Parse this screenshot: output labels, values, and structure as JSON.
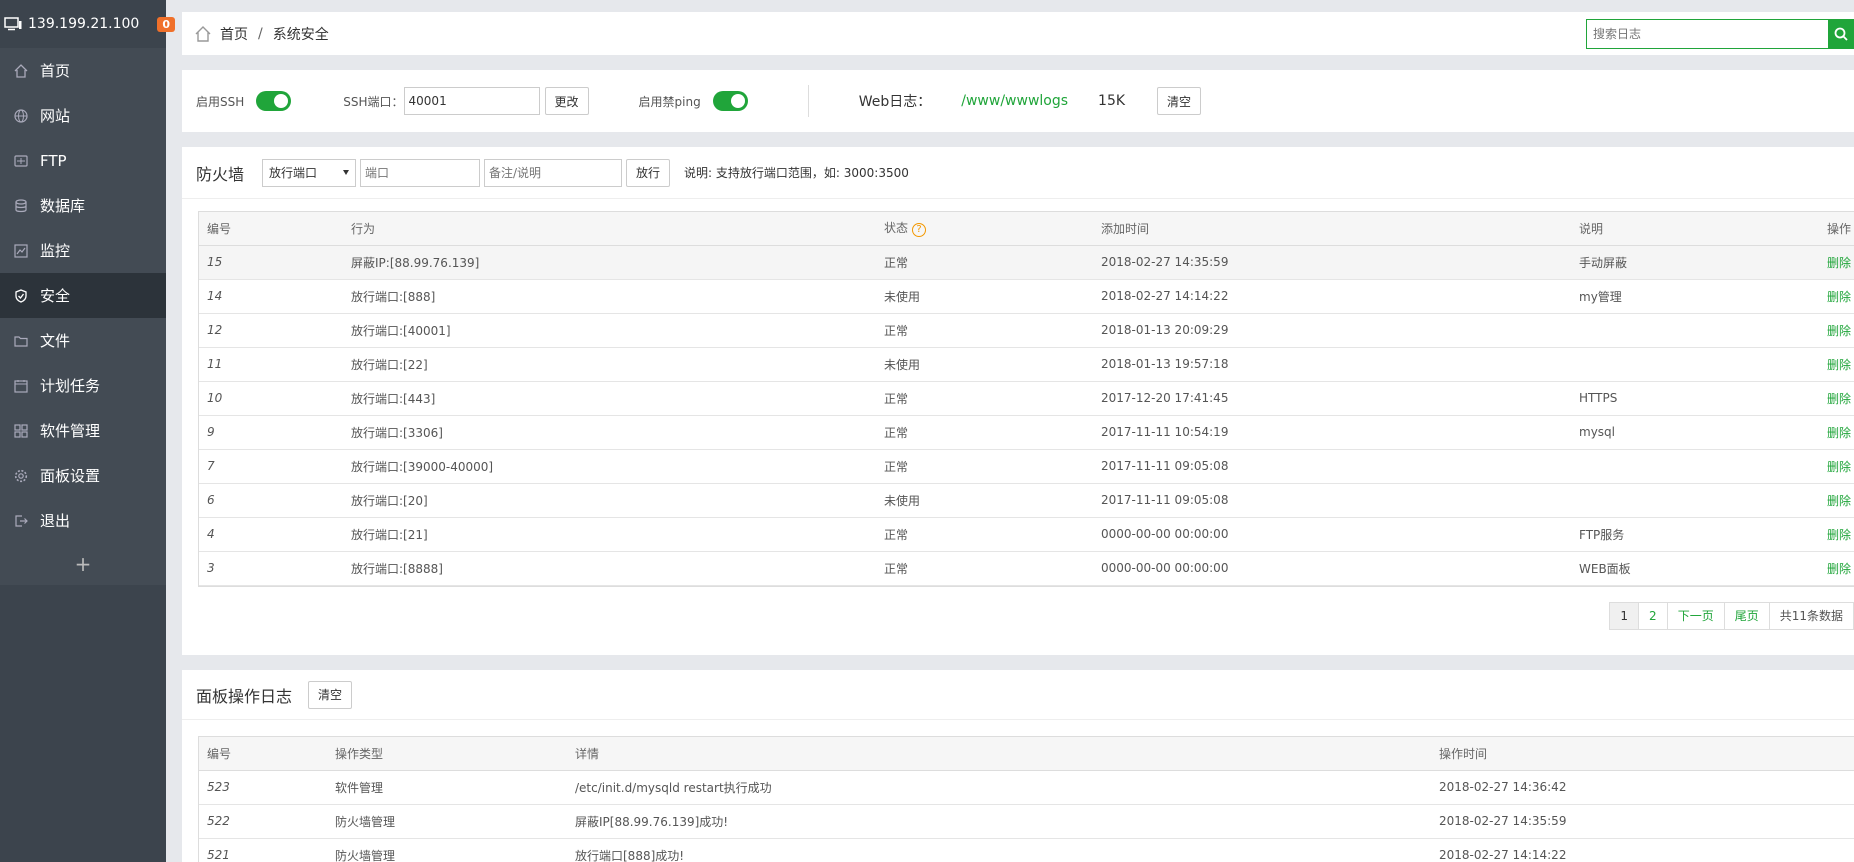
{
  "sidebar": {
    "ip": "139.199.21.100",
    "badge": "0",
    "items": [
      {
        "label": "首页",
        "icon": "home-icon"
      },
      {
        "label": "网站",
        "icon": "globe-icon"
      },
      {
        "label": "FTP",
        "icon": "ftp-icon"
      },
      {
        "label": "数据库",
        "icon": "database-icon"
      },
      {
        "label": "监控",
        "icon": "monitor-icon"
      },
      {
        "label": "安全",
        "icon": "shield-icon"
      },
      {
        "label": "文件",
        "icon": "folder-icon"
      },
      {
        "label": "计划任务",
        "icon": "calendar-icon"
      },
      {
        "label": "软件管理",
        "icon": "apps-icon"
      },
      {
        "label": "面板设置",
        "icon": "gear-icon"
      },
      {
        "label": "退出",
        "icon": "logout-icon"
      }
    ],
    "active_index": 5,
    "add": "+"
  },
  "breadcrumb": {
    "home": "首页",
    "sep": "/",
    "current": "系统安全"
  },
  "search": {
    "placeholder": "搜索日志"
  },
  "ssh": {
    "enable_ssh_label": "启用SSH",
    "port_label": "SSH端口：",
    "port_value": "40001",
    "change_btn": "更改",
    "ping_label": "启用禁ping",
    "weblog_label": "Web日志：",
    "weblog_path": "/www/wwwlogs",
    "weblog_size": "15K",
    "clear_btn": "清空"
  },
  "firewall": {
    "title": "防火墙",
    "select_value": "放行端口",
    "port_placeholder": "端口",
    "remark_placeholder": "备注/说明",
    "allow_btn": "放行",
    "note": "说明: 支持放行端口范围，如: 3000:3500",
    "headers": {
      "id": "编号",
      "action": "行为",
      "status": "状态",
      "status_help": "?",
      "time": "添加时间",
      "remark": "说明",
      "op": "操作"
    },
    "rows": [
      {
        "id": "15",
        "action": "屏蔽IP:[88.99.76.139]",
        "status": "正常",
        "time": "2018-02-27 14:35:59",
        "remark": "手动屏蔽",
        "op": "删除"
      },
      {
        "id": "14",
        "action": "放行端口:[888]",
        "status": "未使用",
        "time": "2018-02-27 14:14:22",
        "remark": "my管理",
        "op": "删除"
      },
      {
        "id": "12",
        "action": "放行端口:[40001]",
        "status": "正常",
        "time": "2018-01-13 20:09:29",
        "remark": "",
        "op": "删除"
      },
      {
        "id": "11",
        "action": "放行端口:[22]",
        "status": "未使用",
        "time": "2018-01-13 19:57:18",
        "remark": "",
        "op": "删除"
      },
      {
        "id": "10",
        "action": "放行端口:[443]",
        "status": "正常",
        "time": "2017-12-20 17:41:45",
        "remark": "HTTPS",
        "op": "删除"
      },
      {
        "id": "9",
        "action": "放行端口:[3306]",
        "status": "正常",
        "time": "2017-11-11 10:54:19",
        "remark": "mysql",
        "op": "删除"
      },
      {
        "id": "7",
        "action": "放行端口:[39000-40000]",
        "status": "正常",
        "time": "2017-11-11 09:05:08",
        "remark": "",
        "op": "删除"
      },
      {
        "id": "6",
        "action": "放行端口:[20]",
        "status": "未使用",
        "time": "2017-11-11 09:05:08",
        "remark": "",
        "op": "删除"
      },
      {
        "id": "4",
        "action": "放行端口:[21]",
        "status": "正常",
        "time": "0000-00-00 00:00:00",
        "remark": "FTP服务",
        "op": "删除"
      },
      {
        "id": "3",
        "action": "放行端口:[8888]",
        "status": "正常",
        "time": "0000-00-00 00:00:00",
        "remark": "WEB面板",
        "op": "删除"
      }
    ],
    "pager": {
      "current": "1",
      "p2": "2",
      "next": "下一页",
      "last": "尾页",
      "total": "共11条数据"
    }
  },
  "panel_log": {
    "title": "面板操作日志",
    "clear_btn": "清空",
    "headers": {
      "id": "编号",
      "type": "操作类型",
      "detail": "详情",
      "time": "操作时间"
    },
    "rows": [
      {
        "id": "523",
        "type": "软件管理",
        "detail": "/etc/init.d/mysqld restart执行成功",
        "time": "2018-02-27 14:36:42"
      },
      {
        "id": "522",
        "type": "防火墙管理",
        "detail": "屏蔽IP[88.99.76.139]成功!",
        "time": "2018-02-27 14:35:59"
      },
      {
        "id": "521",
        "type": "防火墙管理",
        "detail": "放行端口[888]成功!",
        "time": "2018-02-27 14:14:22"
      }
    ]
  }
}
